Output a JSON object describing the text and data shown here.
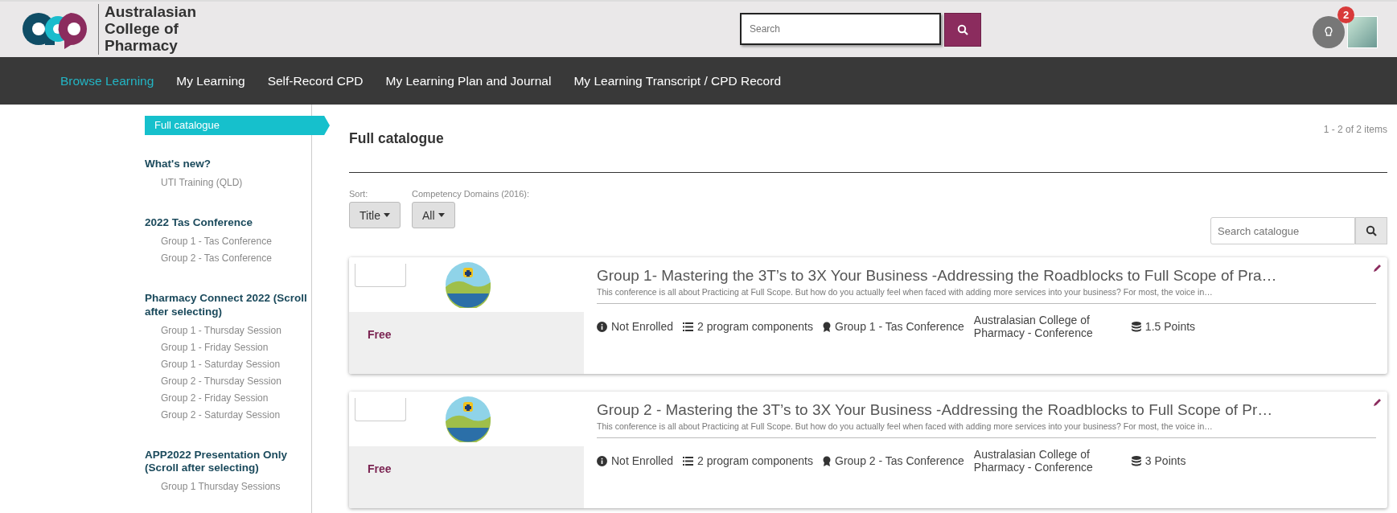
{
  "header": {
    "brand": "Australasian College of Pharmacy",
    "search": {
      "placeholder": "Search"
    },
    "notification_count": "2"
  },
  "nav": [
    {
      "label": "Browse Learning",
      "selected": true
    },
    {
      "label": "My Learning",
      "selected": false
    },
    {
      "label": "Self-Record CPD",
      "selected": false
    },
    {
      "label": "My Learning Plan and Journal",
      "selected": false
    },
    {
      "label": "My Learning Transcript / CPD Record",
      "selected": false
    }
  ],
  "sidebar": {
    "current": "Full catalogue",
    "sections": [
      {
        "title": "What's new?",
        "items": [
          "UTI Training (QLD)"
        ]
      },
      {
        "title": "2022 Tas Conference",
        "items": [
          "Group 1 - Tas Conference",
          "Group 2 - Tas Conference"
        ]
      },
      {
        "title": "Pharmacy Connect 2022 (Scroll after selecting)",
        "items": [
          "Group 1 - Thursday Session",
          "Group 1 - Friday Session",
          "Group 1 - Saturday Session",
          "Group 2 - Thursday Session",
          "Group 2 - Friday Session",
          "Group 2 - Saturday Session"
        ]
      },
      {
        "title": "APP2022 Presentation Only (Scroll after selecting)",
        "items": [
          "Group 1 Thursday Sessions"
        ]
      }
    ]
  },
  "catalogue": {
    "title": "Full catalogue",
    "count": "1 - 2 of 2 items",
    "filters": [
      {
        "label": "Sort:",
        "value": "Title"
      },
      {
        "label": "Competency Domains (2016):",
        "value": "All"
      }
    ],
    "search": {
      "placeholder": "Search catalogue"
    },
    "items": [
      {
        "price": "Free",
        "title": "Group 1- Mastering the 3T’s to 3X Your Business -Addressing the Roadblocks to Full Scope of Pra…",
        "description": "This conference is all about Practicing at Full Scope. But how do you actually feel when faced with adding more services into your business?  For most, the voice in…",
        "status": "Not Enrolled",
        "components": "2 program components",
        "group": "Group 1 - Tas Conference",
        "provider": "Australasian College of Pharmacy - Conference",
        "points": "1.5 Points"
      },
      {
        "price": "Free",
        "title": "Group 2 - Mastering the 3T’s to 3X Your Business -Addressing the Roadblocks to Full Scope of Pr…",
        "description": "This conference is all about Practicing at Full Scope. But how do you actually feel when faced with adding more services into your business?  For most, the voice in…",
        "status": "Not Enrolled",
        "components": "2 program components",
        "group": "Group 2 - Tas Conference",
        "provider": "Australasian College of Pharmacy - Conference",
        "points": "3 Points"
      }
    ]
  }
}
